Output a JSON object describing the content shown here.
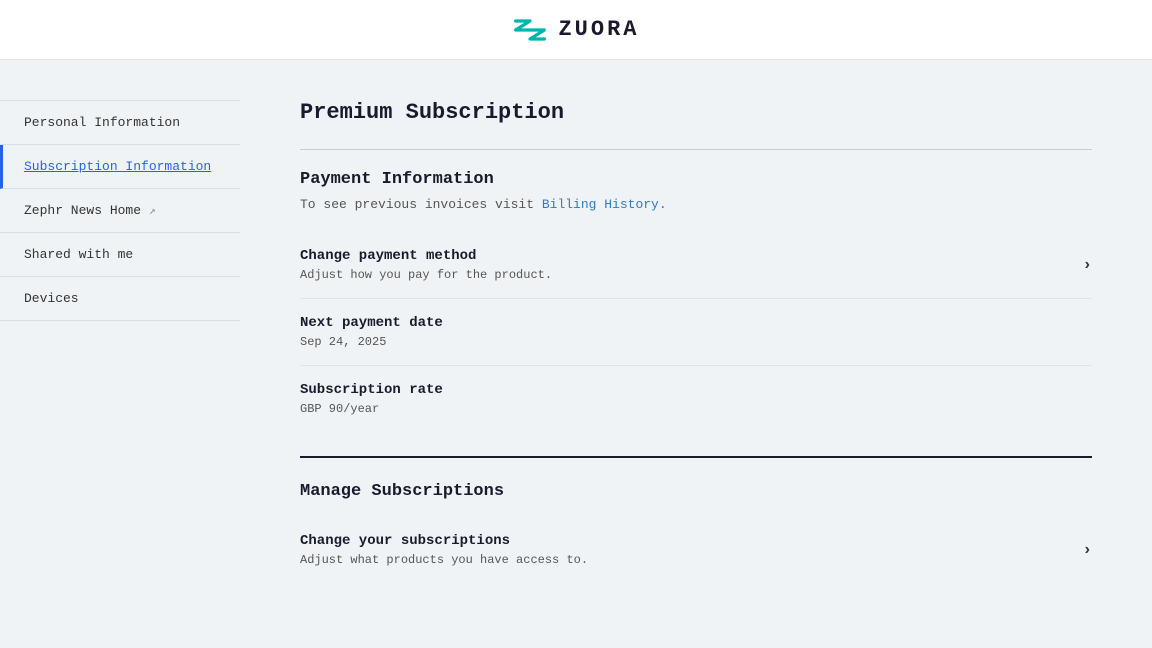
{
  "header": {
    "logo_text": "ZUORA",
    "logo_aria": "Zuora logo"
  },
  "sidebar": {
    "items": [
      {
        "id": "personal-information",
        "label": "Personal Information",
        "active": false,
        "has_external": false
      },
      {
        "id": "subscription-information",
        "label": "Subscription Information",
        "active": true,
        "has_external": false
      },
      {
        "id": "zephr-news-home",
        "label": "Zephr News Home",
        "active": false,
        "has_external": true
      },
      {
        "id": "shared-with-me",
        "label": "Shared with me",
        "active": false,
        "has_external": false
      },
      {
        "id": "devices",
        "label": "Devices",
        "active": false,
        "has_external": false
      }
    ]
  },
  "content": {
    "page_title": "Premium Subscription",
    "payment_section": {
      "title": "Payment Information",
      "subtitle_pre": "To see previous invoices visit ",
      "subtitle_link": "Billing History.",
      "subtitle_link_href": "#"
    },
    "payment_rows": [
      {
        "id": "change-payment-method",
        "title": "Change payment method",
        "description": "Adjust how you pay for the product.",
        "has_chevron": true
      },
      {
        "id": "next-payment-date",
        "title": "Next payment date",
        "description": "Sep 24, 2025",
        "has_chevron": false
      },
      {
        "id": "subscription-rate",
        "title": "Subscription rate",
        "description": "GBP 90/year",
        "has_chevron": false
      }
    ],
    "manage_section": {
      "title": "Manage Subscriptions",
      "rows": [
        {
          "id": "change-subscriptions",
          "title": "Change your subscriptions",
          "description": "Adjust what products you have access to.",
          "has_chevron": true
        }
      ]
    }
  }
}
